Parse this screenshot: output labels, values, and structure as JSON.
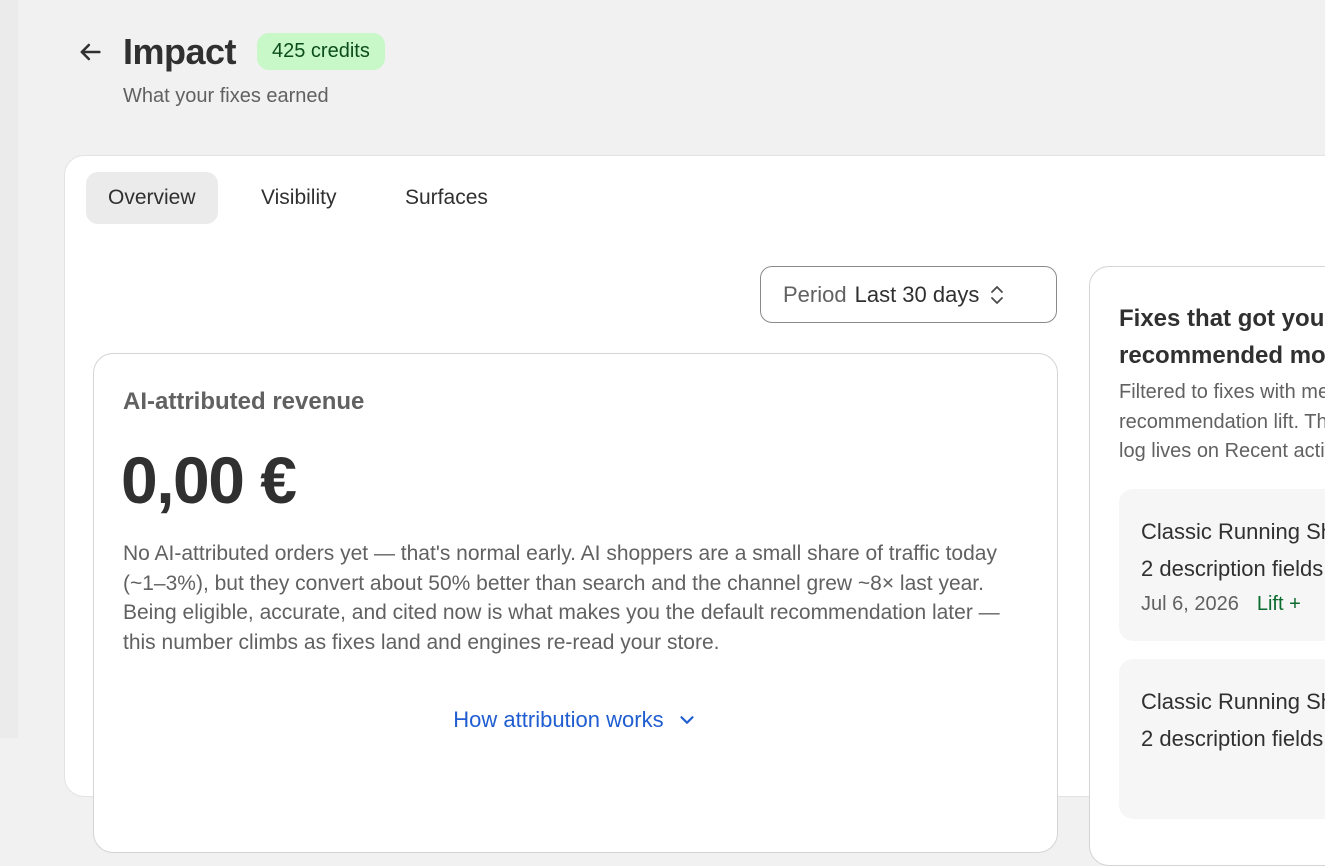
{
  "header": {
    "title": "Impact",
    "credits_badge": "425 credits",
    "subtitle": "What your fixes earned"
  },
  "tabs": [
    {
      "label": "Overview",
      "active": true
    },
    {
      "label": "Visibility",
      "active": false
    },
    {
      "label": "Surfaces",
      "active": false
    }
  ],
  "period": {
    "label": "Period",
    "value": "Last 30 days"
  },
  "revenue": {
    "title": "AI-attributed revenue",
    "amount": "0,00 €",
    "description": "No AI-attributed orders yet — that's normal early. AI shoppers are a small share of traffic today (~1–3%), but they convert about 50% better than search and the channel grew ~8× last year. Being eligible, accurate, and cited now is what makes you the default recommendation later — this number climbs as fixes land and engines re-read your store.",
    "link": "How attribution works"
  },
  "fixes_panel": {
    "title": "Fixes that got you recommended more",
    "desc_lines": [
      "Filtered to fixes with measurable",
      "recommendation lift. The full",
      "log lives on Recent activity."
    ],
    "items": [
      {
        "name": "Classic Running Shoe",
        "count": "2 description fields",
        "date": "Jul 6, 2026",
        "lift": "Lift +"
      },
      {
        "name": "Classic Running Shoe",
        "count": "2 description fields",
        "date": "",
        "lift": ""
      }
    ]
  },
  "colors": {
    "page_bg": "#f1f1f1",
    "badge_bg": "#c8f7c8",
    "badge_text": "#0b4d1c",
    "link": "#1f5dd1",
    "lift": "#0b6b2e"
  },
  "icons": {
    "back": "arrow-left-icon",
    "period_selector": "chevron-up-down-icon",
    "link_expand": "chevron-down-icon"
  }
}
